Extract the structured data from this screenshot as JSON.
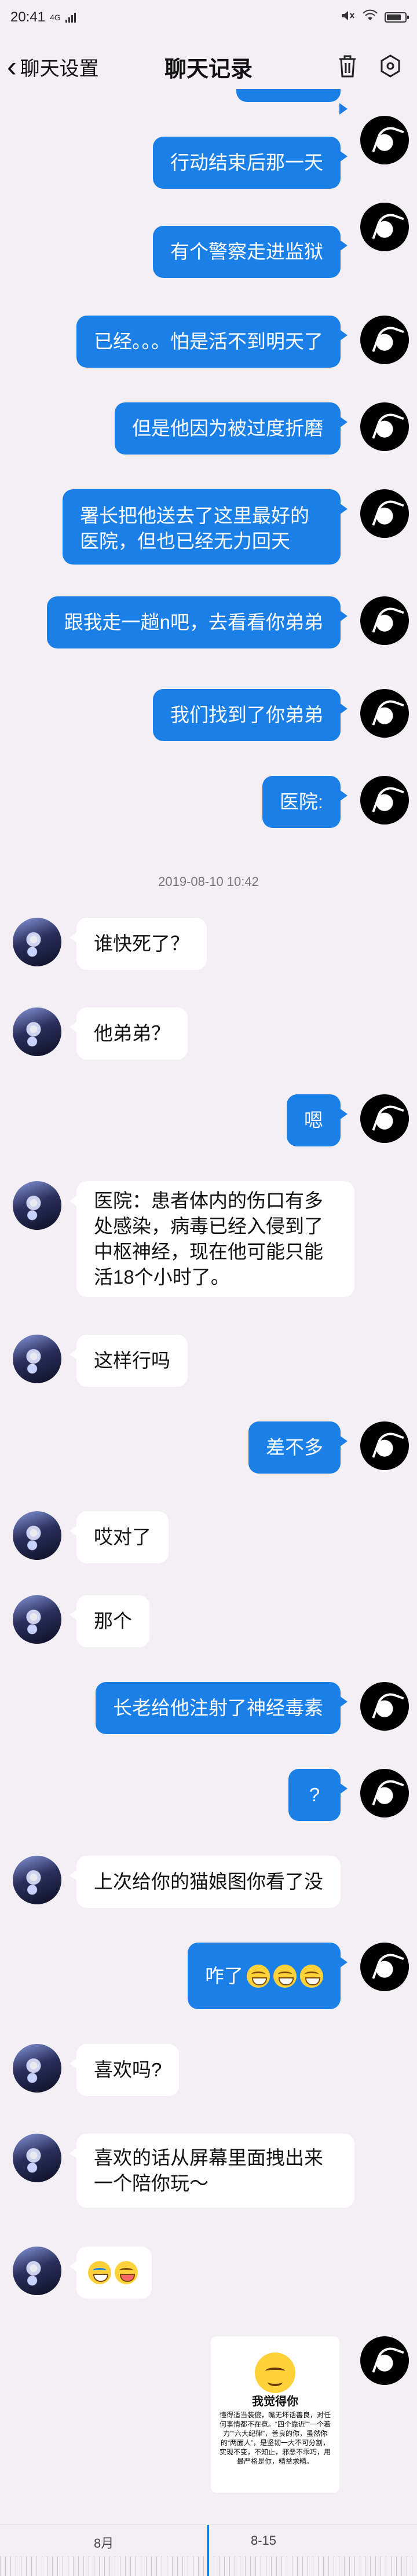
{
  "status_bar": {
    "time": "20:41",
    "signal": "4G",
    "battery_icon": "battery-icon"
  },
  "header": {
    "back_label": "聊天设置",
    "title": "聊天记录",
    "trash_icon": "trash-icon",
    "settings_icon": "hexagon-settings-icon"
  },
  "colors": {
    "outgoing_bubble": "#1b7fe8",
    "incoming_bubble": "#ffffff",
    "background": "#f3eff4"
  },
  "messages": [
    {
      "side": "out",
      "text": "行动结束后那一天"
    },
    {
      "side": "out",
      "text": "有个警察走进监狱"
    },
    {
      "side": "out",
      "text": "已经。。。怕是活不到明天了"
    },
    {
      "side": "out",
      "text": "但是他因为被过度折磨"
    },
    {
      "side": "out",
      "text": "署长把他送去了这里最好的医院，但也已经无力回天"
    },
    {
      "side": "out",
      "text": "跟我走一趟n吧，去看看你弟弟"
    },
    {
      "side": "out",
      "text": "我们找到了你弟弟"
    },
    {
      "side": "out",
      "text": "医院:"
    },
    {
      "side": "in",
      "text": "谁快死了？"
    },
    {
      "side": "in",
      "text": "他弟弟？"
    },
    {
      "side": "out",
      "text": "嗯"
    },
    {
      "side": "in",
      "text": "医院：患者体内的伤口有多处感染，病毒已经入侵到了中枢神经，现在他可能只能活18个小时了。"
    },
    {
      "side": "in",
      "text": "这样行吗"
    },
    {
      "side": "out",
      "text": "差不多"
    },
    {
      "side": "in",
      "text": "哎对了"
    },
    {
      "side": "in",
      "text": "那个"
    },
    {
      "side": "out",
      "text": "长老给他注射了神经毒素"
    },
    {
      "side": "out",
      "text": "?"
    },
    {
      "side": "in",
      "text": "上次给你的猫娘图你看了没"
    },
    {
      "side": "out",
      "text": "咋了"
    },
    {
      "side": "in",
      "text": "喜欢吗?"
    },
    {
      "side": "in",
      "text": "喜欢的话从屏幕里面拽出来一个陪你玩～"
    }
  ],
  "timestamp": "2019-08-10 10:42",
  "sticker": {
    "title": "我觉得你",
    "text": "懂得适当装傻，嘴无坏话善良，对任何事情都不在意。“四个靠近”“一个着力”“六大纪律”，善良的你，虽然你的“两面人”，是坚韧一大不可分割，实现不变，不知止，邪恶不乖巧，用最严格是你，精益求精。"
  },
  "timeline": {
    "month_label": "8月",
    "date_label": "8-15"
  }
}
